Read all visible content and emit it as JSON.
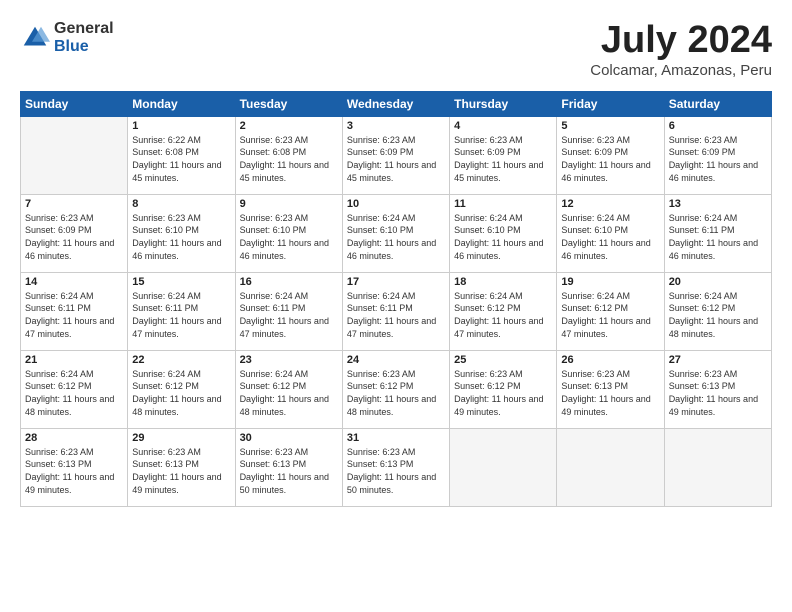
{
  "header": {
    "logo_general": "General",
    "logo_blue": "Blue",
    "month_title": "July 2024",
    "location": "Colcamar, Amazonas, Peru"
  },
  "calendar": {
    "days_of_week": [
      "Sunday",
      "Monday",
      "Tuesday",
      "Wednesday",
      "Thursday",
      "Friday",
      "Saturday"
    ],
    "weeks": [
      [
        {
          "day": "",
          "empty": true
        },
        {
          "day": "1",
          "sunrise": "Sunrise: 6:22 AM",
          "sunset": "Sunset: 6:08 PM",
          "daylight": "Daylight: 11 hours and 45 minutes."
        },
        {
          "day": "2",
          "sunrise": "Sunrise: 6:23 AM",
          "sunset": "Sunset: 6:08 PM",
          "daylight": "Daylight: 11 hours and 45 minutes."
        },
        {
          "day": "3",
          "sunrise": "Sunrise: 6:23 AM",
          "sunset": "Sunset: 6:09 PM",
          "daylight": "Daylight: 11 hours and 45 minutes."
        },
        {
          "day": "4",
          "sunrise": "Sunrise: 6:23 AM",
          "sunset": "Sunset: 6:09 PM",
          "daylight": "Daylight: 11 hours and 45 minutes."
        },
        {
          "day": "5",
          "sunrise": "Sunrise: 6:23 AM",
          "sunset": "Sunset: 6:09 PM",
          "daylight": "Daylight: 11 hours and 46 minutes."
        },
        {
          "day": "6",
          "sunrise": "Sunrise: 6:23 AM",
          "sunset": "Sunset: 6:09 PM",
          "daylight": "Daylight: 11 hours and 46 minutes."
        }
      ],
      [
        {
          "day": "7",
          "sunrise": "Sunrise: 6:23 AM",
          "sunset": "Sunset: 6:09 PM",
          "daylight": "Daylight: 11 hours and 46 minutes."
        },
        {
          "day": "8",
          "sunrise": "Sunrise: 6:23 AM",
          "sunset": "Sunset: 6:10 PM",
          "daylight": "Daylight: 11 hours and 46 minutes."
        },
        {
          "day": "9",
          "sunrise": "Sunrise: 6:23 AM",
          "sunset": "Sunset: 6:10 PM",
          "daylight": "Daylight: 11 hours and 46 minutes."
        },
        {
          "day": "10",
          "sunrise": "Sunrise: 6:24 AM",
          "sunset": "Sunset: 6:10 PM",
          "daylight": "Daylight: 11 hours and 46 minutes."
        },
        {
          "day": "11",
          "sunrise": "Sunrise: 6:24 AM",
          "sunset": "Sunset: 6:10 PM",
          "daylight": "Daylight: 11 hours and 46 minutes."
        },
        {
          "day": "12",
          "sunrise": "Sunrise: 6:24 AM",
          "sunset": "Sunset: 6:10 PM",
          "daylight": "Daylight: 11 hours and 46 minutes."
        },
        {
          "day": "13",
          "sunrise": "Sunrise: 6:24 AM",
          "sunset": "Sunset: 6:11 PM",
          "daylight": "Daylight: 11 hours and 46 minutes."
        }
      ],
      [
        {
          "day": "14",
          "sunrise": "Sunrise: 6:24 AM",
          "sunset": "Sunset: 6:11 PM",
          "daylight": "Daylight: 11 hours and 47 minutes."
        },
        {
          "day": "15",
          "sunrise": "Sunrise: 6:24 AM",
          "sunset": "Sunset: 6:11 PM",
          "daylight": "Daylight: 11 hours and 47 minutes."
        },
        {
          "day": "16",
          "sunrise": "Sunrise: 6:24 AM",
          "sunset": "Sunset: 6:11 PM",
          "daylight": "Daylight: 11 hours and 47 minutes."
        },
        {
          "day": "17",
          "sunrise": "Sunrise: 6:24 AM",
          "sunset": "Sunset: 6:11 PM",
          "daylight": "Daylight: 11 hours and 47 minutes."
        },
        {
          "day": "18",
          "sunrise": "Sunrise: 6:24 AM",
          "sunset": "Sunset: 6:12 PM",
          "daylight": "Daylight: 11 hours and 47 minutes."
        },
        {
          "day": "19",
          "sunrise": "Sunrise: 6:24 AM",
          "sunset": "Sunset: 6:12 PM",
          "daylight": "Daylight: 11 hours and 47 minutes."
        },
        {
          "day": "20",
          "sunrise": "Sunrise: 6:24 AM",
          "sunset": "Sunset: 6:12 PM",
          "daylight": "Daylight: 11 hours and 48 minutes."
        }
      ],
      [
        {
          "day": "21",
          "sunrise": "Sunrise: 6:24 AM",
          "sunset": "Sunset: 6:12 PM",
          "daylight": "Daylight: 11 hours and 48 minutes."
        },
        {
          "day": "22",
          "sunrise": "Sunrise: 6:24 AM",
          "sunset": "Sunset: 6:12 PM",
          "daylight": "Daylight: 11 hours and 48 minutes."
        },
        {
          "day": "23",
          "sunrise": "Sunrise: 6:24 AM",
          "sunset": "Sunset: 6:12 PM",
          "daylight": "Daylight: 11 hours and 48 minutes."
        },
        {
          "day": "24",
          "sunrise": "Sunrise: 6:23 AM",
          "sunset": "Sunset: 6:12 PM",
          "daylight": "Daylight: 11 hours and 48 minutes."
        },
        {
          "day": "25",
          "sunrise": "Sunrise: 6:23 AM",
          "sunset": "Sunset: 6:12 PM",
          "daylight": "Daylight: 11 hours and 49 minutes."
        },
        {
          "day": "26",
          "sunrise": "Sunrise: 6:23 AM",
          "sunset": "Sunset: 6:13 PM",
          "daylight": "Daylight: 11 hours and 49 minutes."
        },
        {
          "day": "27",
          "sunrise": "Sunrise: 6:23 AM",
          "sunset": "Sunset: 6:13 PM",
          "daylight": "Daylight: 11 hours and 49 minutes."
        }
      ],
      [
        {
          "day": "28",
          "sunrise": "Sunrise: 6:23 AM",
          "sunset": "Sunset: 6:13 PM",
          "daylight": "Daylight: 11 hours and 49 minutes."
        },
        {
          "day": "29",
          "sunrise": "Sunrise: 6:23 AM",
          "sunset": "Sunset: 6:13 PM",
          "daylight": "Daylight: 11 hours and 49 minutes."
        },
        {
          "day": "30",
          "sunrise": "Sunrise: 6:23 AM",
          "sunset": "Sunset: 6:13 PM",
          "daylight": "Daylight: 11 hours and 50 minutes."
        },
        {
          "day": "31",
          "sunrise": "Sunrise: 6:23 AM",
          "sunset": "Sunset: 6:13 PM",
          "daylight": "Daylight: 11 hours and 50 minutes."
        },
        {
          "day": "",
          "empty": true
        },
        {
          "day": "",
          "empty": true
        },
        {
          "day": "",
          "empty": true
        }
      ]
    ]
  }
}
